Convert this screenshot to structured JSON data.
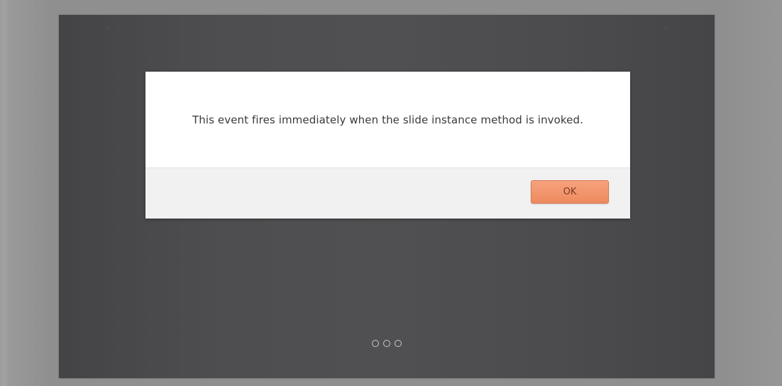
{
  "carousel": {
    "indicator_count": 3,
    "prev_icon": "chevron-left-icon",
    "next_icon": "chevron-right-icon"
  },
  "dialog": {
    "message": "This event fires immediately when the slide instance method is invoked.",
    "ok_label": "OK"
  },
  "colors": {
    "carousel_background": "#4d4d4f",
    "ok_button": "#f08f63",
    "dialog_footer": "#f1f1f1"
  }
}
